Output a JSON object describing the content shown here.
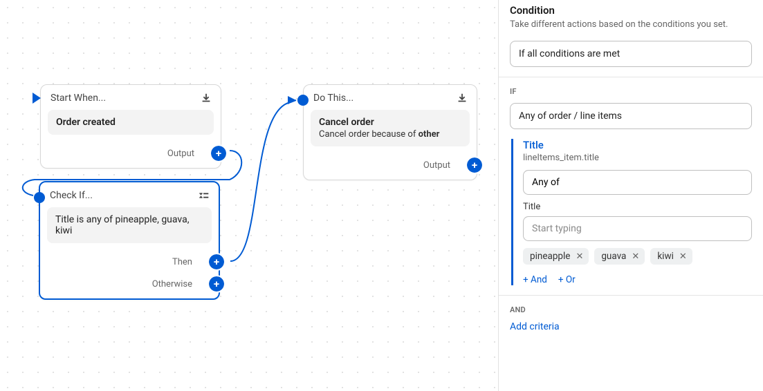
{
  "canvas": {
    "startNode": {
      "title": "Start When...",
      "body": "Order created",
      "outputLabel": "Output"
    },
    "checkNode": {
      "title": "Check If...",
      "body": "Title is any of pineapple, guava, kiwi",
      "thenLabel": "Then",
      "otherwiseLabel": "Otherwise"
    },
    "actionNode": {
      "title": "Do This...",
      "body": "Cancel order",
      "subline_pre": "Cancel order because of ",
      "subline_bold": "other",
      "outputLabel": "Output"
    }
  },
  "panel": {
    "title": "Condition",
    "desc": "Take different actions based on the conditions you set.",
    "select_all": "If all conditions are met",
    "ifLabel": "IF",
    "select_scope": "Any of order / line items",
    "criteria": {
      "title": "Title",
      "path": "lineItems_item.title",
      "operator": "Any of",
      "fieldLabel": "Title",
      "placeholder": "Start typing",
      "tags": [
        "pineapple",
        "guava",
        "kiwi"
      ]
    },
    "andLink": "+ And",
    "orLink": "+ Or",
    "andLabel": "AND",
    "addCriteria": "Add criteria"
  }
}
